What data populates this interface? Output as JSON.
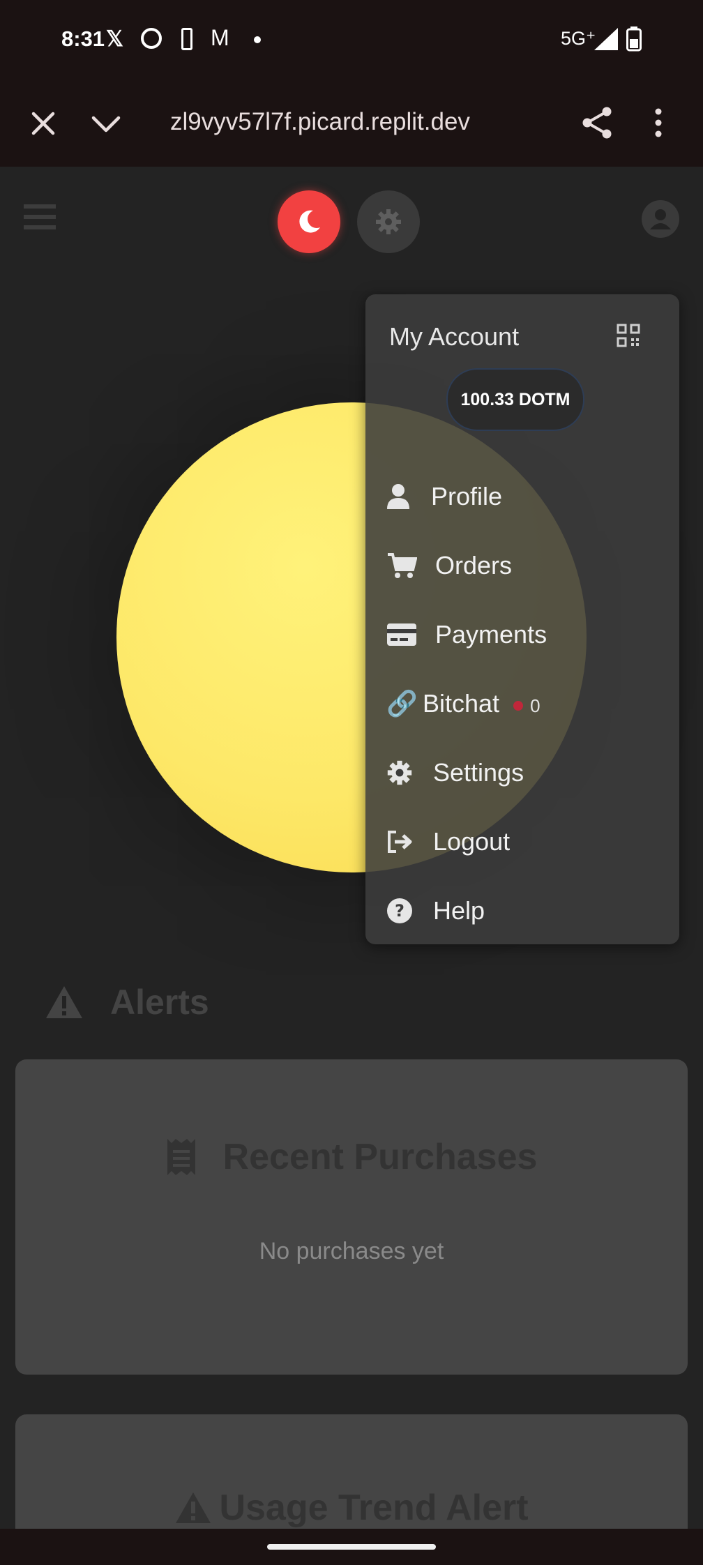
{
  "status_bar": {
    "time": "8:31",
    "network": "5G⁺",
    "notification_icons": [
      "x-icon",
      "spiral-icon",
      "nba-icon",
      "gmail-icon",
      "dot-icon"
    ]
  },
  "browser": {
    "url": "zl9vyv57l7f.picard.replit.dev"
  },
  "menu": {
    "title": "My Account",
    "balance": "100.33 DOTM",
    "items": [
      {
        "label": "Profile",
        "icon": "user-icon"
      },
      {
        "label": "Orders",
        "icon": "cart-icon"
      },
      {
        "label": "Payments",
        "icon": "credit-card-icon"
      },
      {
        "label": "Bitchat",
        "icon": "link-icon",
        "badge_count": "0"
      },
      {
        "label": "Settings",
        "icon": "gear-icon"
      },
      {
        "label": "Logout",
        "icon": "logout-icon"
      },
      {
        "label": "Help",
        "icon": "help-icon"
      }
    ]
  },
  "alerts": {
    "title": "Alerts"
  },
  "recent_purchases": {
    "title": "Recent Purchases",
    "empty_text": "No purchases yet"
  },
  "usage_trend": {
    "title": "Usage Trend Alert"
  },
  "colors": {
    "accent_red": "#f24141",
    "sun_yellow": "#fde868",
    "badge_red": "#c0273a"
  }
}
